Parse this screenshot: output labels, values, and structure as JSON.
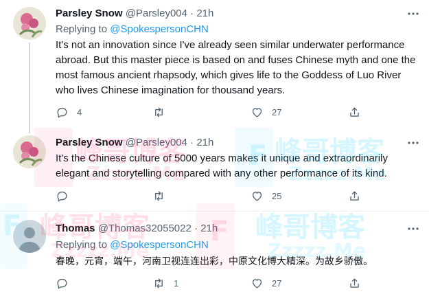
{
  "tweets": [
    {
      "name": "Parsley Snow",
      "handle": "@Parsley004",
      "separator": "·",
      "time": "21h",
      "replying_prefix": "Replying to ",
      "replying_to": "@SpokespersonCHN",
      "text": "It's not an innovation since I've already seen similar underwater performance abroad. But this master piece is based on and fuses Chinese myth and one the most famous ancient rhapsody, which gives life to the Goddess of Luo River who lives Chinese imagination for thousand years.",
      "reply_count": "4",
      "retweet_count": "",
      "like_count": "27"
    },
    {
      "name": "Parsley Snow",
      "handle": "@Parsley004",
      "separator": "·",
      "time": "21h",
      "text": "It's the Chinese culture of 5000 years makes it unique and extraordinarily elegant and storytelling compared with any other performance of its kind.",
      "reply_count": "",
      "retweet_count": "",
      "like_count": "25"
    },
    {
      "name": "Thomas",
      "handle": "@Thomas32055022",
      "separator": "·",
      "time": "21h",
      "replying_prefix": "Replying to ",
      "replying_to": "@SpokespersonCHN",
      "text": "春晚，元宵，端午，河南卫视连连出彩，中原文化博大精深。为故乡骄傲。",
      "reply_count": "",
      "retweet_count": "1",
      "like_count": "27"
    }
  ],
  "watermark": {
    "cn": "峰哥博客",
    "en": "Zzzzz.Me",
    "letter": "F"
  },
  "colors": {
    "accent": "#1d9bf0",
    "text": "#0f1419",
    "muted": "#536471",
    "watermark_pink": "#ff2e6e",
    "watermark_cyan": "#2fd1ff"
  },
  "icons": [
    "more-icon",
    "reply-icon",
    "retweet-icon",
    "like-icon",
    "share-icon"
  ]
}
